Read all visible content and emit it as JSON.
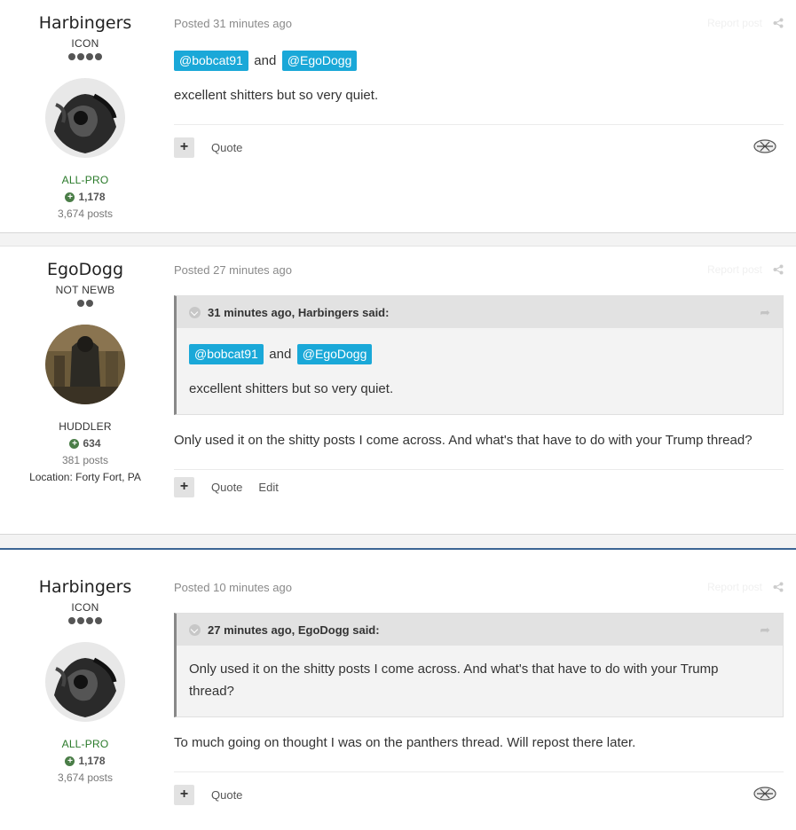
{
  "posts": [
    {
      "author": {
        "name": "Harbingers",
        "rank": "ICON",
        "pips": 4,
        "title": "ALL-PRO",
        "title_color": "#2a7a2a",
        "reputation": "1,178",
        "post_count": "3,674 posts"
      },
      "posted": "Posted 31 minutes ago",
      "report_label": "Report post",
      "mentions": [
        "@bobcat91",
        "@EgoDogg"
      ],
      "mention_joiner": "and",
      "text": "excellent shitters but so very quiet.",
      "actions": {
        "quote": "Quote"
      }
    },
    {
      "author": {
        "name": "EgoDogg",
        "rank": "NOT NEWB",
        "pips": 2,
        "title": "HUDDLER",
        "title_color": "#333333",
        "reputation": "634",
        "post_count": "381 posts",
        "location": "Location: Forty Fort, PA"
      },
      "posted": "Posted 27 minutes ago",
      "report_label": "Report post",
      "quote": {
        "header": "31 minutes ago, Harbingers said:",
        "mentions": [
          "@bobcat91",
          "@EgoDogg"
        ],
        "mention_joiner": "and",
        "text": "excellent shitters but so very quiet."
      },
      "text": "Only used it on the shitty posts I come across. And what's that have to do with your Trump thread?",
      "actions": {
        "quote": "Quote",
        "edit": "Edit"
      }
    },
    {
      "author": {
        "name": "Harbingers",
        "rank": "ICON",
        "pips": 4,
        "title": "ALL-PRO",
        "title_color": "#2a7a2a",
        "reputation": "1,178",
        "post_count": "3,674 posts"
      },
      "posted": "Posted 10 minutes ago",
      "report_label": "Report post",
      "quote": {
        "header": "27 minutes ago, EgoDogg said:",
        "text": "Only used it on the shitty posts I come across. And what's that have to do with your Trump thread?"
      },
      "text": "To much going on thought I was on the panthers thread. Will repost there later.",
      "actions": {
        "quote": "Quote"
      }
    }
  ],
  "icons": {
    "share": "share-icon",
    "add": "plus-icon",
    "reaction": "reaction-icon",
    "quote_toggle": "chevron-down-icon",
    "quote_link": "arrow-right-icon",
    "rep": "plus-circle-icon"
  },
  "colors": {
    "mention_bg": "#1aa8d8",
    "separator_accent": "#3d6594"
  }
}
